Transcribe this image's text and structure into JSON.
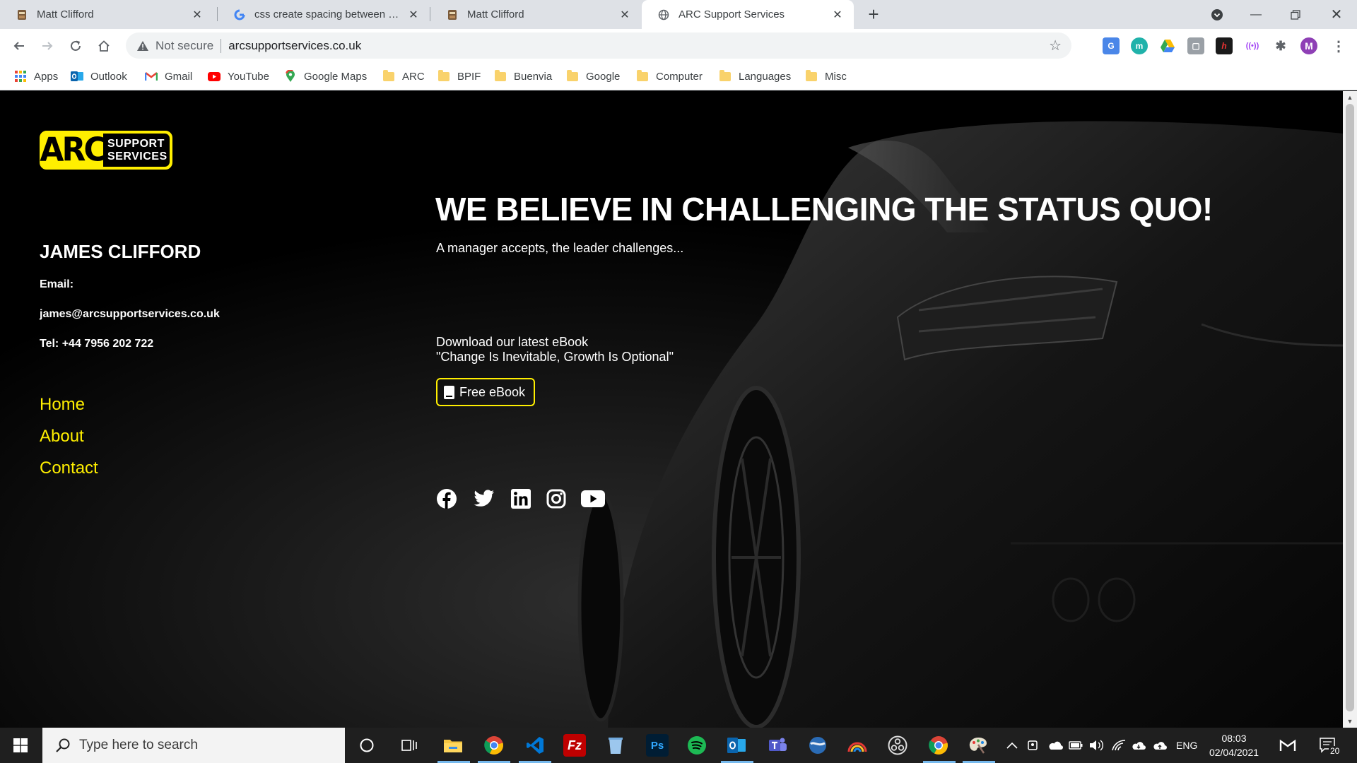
{
  "browser": {
    "tabs": [
      {
        "label": "Matt Clifford",
        "icon": "page-icon"
      },
      {
        "label": "css create spacing between word",
        "icon": "google-icon"
      },
      {
        "label": "Matt Clifford",
        "icon": "page-icon"
      },
      {
        "label": "ARC Support Services",
        "icon": "globe-icon",
        "active": true
      }
    ],
    "address": {
      "security_label": "Not secure",
      "url": "arcsupportservices.co.uk"
    },
    "profile_initial": "M",
    "bookmarks": [
      {
        "label": "Apps",
        "icon": "apps-grid-icon"
      },
      {
        "label": "Outlook",
        "icon": "outlook-icon"
      },
      {
        "label": "Gmail",
        "icon": "gmail-icon"
      },
      {
        "label": "YouTube",
        "icon": "youtube-icon"
      },
      {
        "label": "Google Maps",
        "icon": "maps-pin-icon"
      },
      {
        "label": "ARC",
        "icon": "folder-icon"
      },
      {
        "label": "BPIF",
        "icon": "folder-icon"
      },
      {
        "label": "Buenvia",
        "icon": "folder-icon"
      },
      {
        "label": "Google",
        "icon": "folder-icon"
      },
      {
        "label": "Computer",
        "icon": "folder-icon"
      },
      {
        "label": "Languages",
        "icon": "folder-icon"
      },
      {
        "label": "Misc",
        "icon": "folder-icon"
      }
    ]
  },
  "page": {
    "logo": {
      "mark": "ARC",
      "line1": "SUPPORT",
      "line2": "SERVICES"
    },
    "contact": {
      "name": "JAMES CLIFFORD",
      "email_label": "Email:",
      "email": "james@arcsupportservices.co.uk",
      "tel": "Tel: +44 7956 202 722"
    },
    "nav": [
      "Home",
      "About",
      "Contact"
    ],
    "hero": {
      "title": "WE BELIEVE IN CHALLENGING THE STATUS QUO!",
      "subtitle": "A manager accepts, the leader challenges...",
      "ebook_line1": "Download our latest eBook",
      "ebook_line2": "\"Change Is Inevitable, Growth Is Optional\"",
      "ebook_button": "Free eBook"
    },
    "social": [
      "facebook-icon",
      "twitter-icon",
      "linkedin-icon",
      "instagram-icon",
      "youtube-icon"
    ],
    "accent_color": "#ffef00"
  },
  "taskbar": {
    "search_placeholder": "Type here to search",
    "language": "ENG",
    "time": "08:03",
    "date": "02/04/2021",
    "notification_count": "20"
  }
}
